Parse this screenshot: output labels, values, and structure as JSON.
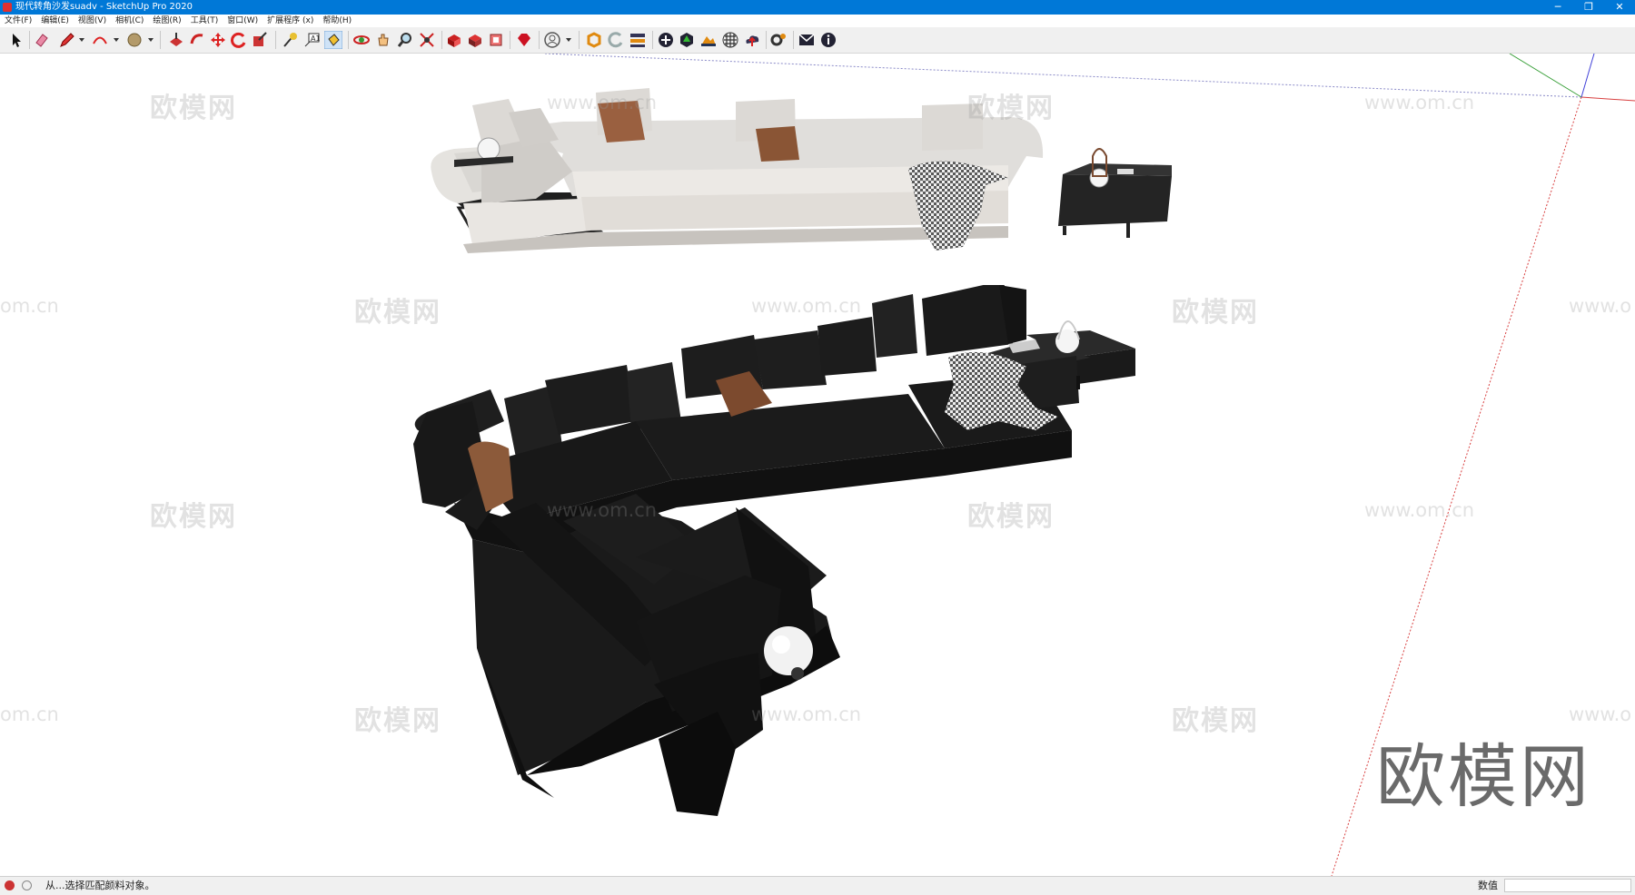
{
  "window": {
    "title": "现代转角沙发suadv - SketchUp Pro 2020",
    "controls": [
      "─",
      "❐",
      "✕"
    ]
  },
  "menu": [
    "文件(F)",
    "编辑(E)",
    "视图(V)",
    "相机(C)",
    "绘图(R)",
    "工具(T)",
    "窗口(W)",
    "扩展程序 (x)",
    "帮助(H)"
  ],
  "toolbar": {
    "icons": [
      "select-icon",
      "eraser-icon",
      "pencil-icon",
      "arc-icon",
      "circle-icon",
      "push-pull-icon",
      "follow-me-icon",
      "move-icon",
      "rotate-icon",
      "scale-icon",
      "tape-measure-icon",
      "text-icon",
      "paint-bucket-icon",
      "orbit-icon",
      "pan-icon",
      "zoom-icon",
      "zoom-extents-icon",
      "3d-warehouse-icon",
      "extension-warehouse-icon",
      "layout-icon",
      "ruby-icon",
      "account-icon",
      "sync-icon",
      "refresh-icon",
      "scenes-icon",
      "add-icon",
      "sandbox-icon",
      "terrain-icon",
      "material-icon",
      "cloud-icon",
      "settings-icon",
      "mail-icon",
      "info-icon"
    ]
  },
  "viewport": {
    "watermarks": [
      "欧模网",
      "www.om.cn"
    ],
    "watermark_partials": [
      "om.cn",
      "www.o"
    ],
    "brand": "欧模网"
  },
  "status": {
    "message": "从...选择匹配颜料对象。",
    "value_label": "数值",
    "value": ""
  }
}
